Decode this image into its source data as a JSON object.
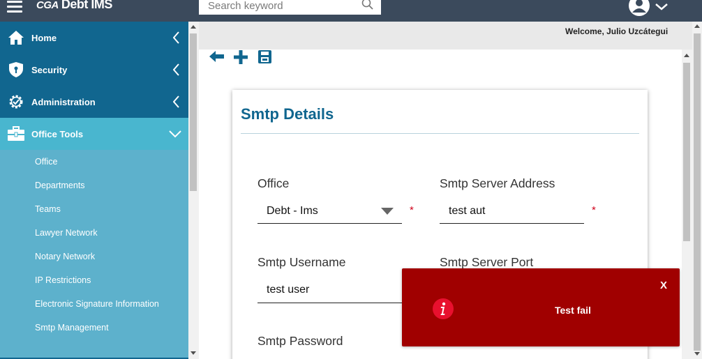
{
  "app": {
    "logo_mark": "CGA",
    "title": "Debt IMS"
  },
  "search": {
    "placeholder": "Search keyword",
    "icon": "search-icon"
  },
  "user": {
    "icon": "user-icon",
    "menu_icon": "chevron-down-icon"
  },
  "welcome": "Welcome, Julio Uzcátegui",
  "sidebar": {
    "main": [
      {
        "label": "Home",
        "icon": "home-icon"
      },
      {
        "label": "Security",
        "icon": "shield-icon"
      },
      {
        "label": "Administration",
        "icon": "gear-check-icon"
      },
      {
        "label": "Office Tools",
        "icon": "toolbox-icon",
        "expanded": true
      }
    ],
    "sub": [
      {
        "label": "Office"
      },
      {
        "label": "Departments"
      },
      {
        "label": "Teams"
      },
      {
        "label": "Lawyer Network"
      },
      {
        "label": "Notary Network"
      },
      {
        "label": "IP Restrictions"
      },
      {
        "label": "Electronic Signature Information"
      },
      {
        "label": "Smtp Management"
      }
    ]
  },
  "toolbar": {
    "back_icon": "arrow-left-icon",
    "add_icon": "plus-icon",
    "save_icon": "save-icon"
  },
  "form": {
    "title": "Smtp Details",
    "office": {
      "label": "Office",
      "value": "Debt - Ims",
      "required": "*"
    },
    "server_address": {
      "label": "Smtp Server Address",
      "value": "test aut",
      "required": "*"
    },
    "username": {
      "label": "Smtp Username",
      "value": "test user"
    },
    "port": {
      "label": "Smtp Server Port"
    },
    "password": {
      "label": "Smtp Password"
    }
  },
  "toast": {
    "message": "Test fail",
    "close_label": "X",
    "icon": "info-icon"
  },
  "colors": {
    "topbar": "#3b4a5c",
    "sidebar_main": "#11668f",
    "sidebar_active": "#49b6cf",
    "sidebar_sub": "#5db1cc",
    "title": "#10668f",
    "toast": "#a00000",
    "required": "#d0021b"
  }
}
